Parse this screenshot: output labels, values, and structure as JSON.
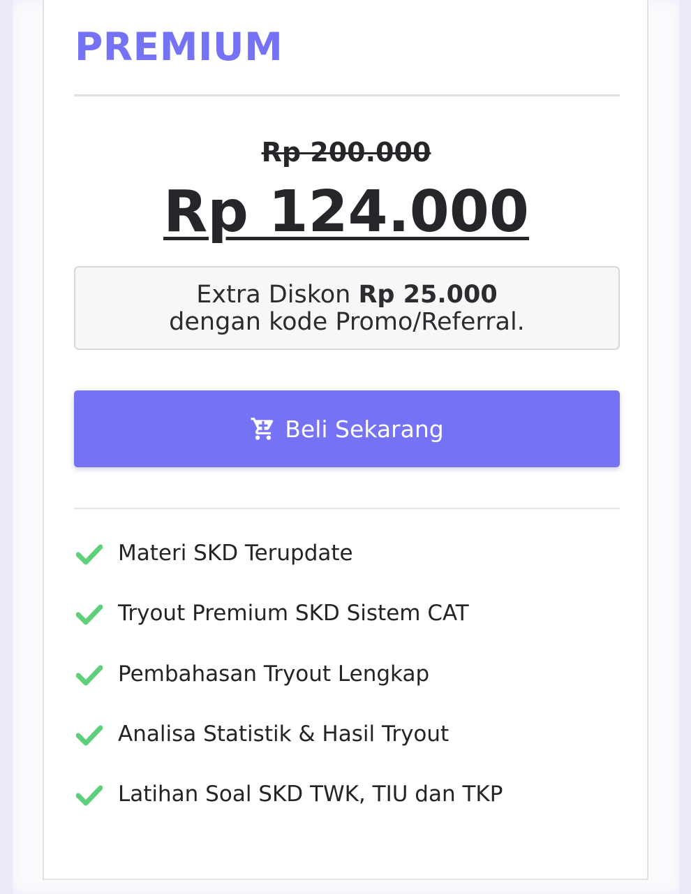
{
  "plan": {
    "title": "PREMIUM",
    "price_original": "Rp 200.000",
    "price_current": "Rp 124.000"
  },
  "promo": {
    "prefix": "Extra Diskon",
    "amount": "Rp 25.000",
    "line2": "dengan kode Promo/Referral."
  },
  "cta": {
    "label": "Beli Sekarang",
    "icon": "cart-icon"
  },
  "features": [
    {
      "label": "Materi SKD Terupdate",
      "icon": "check-icon"
    },
    {
      "label": "Tryout Premium SKD Sistem CAT",
      "icon": "check-icon"
    },
    {
      "label": "Pembahasan Tryout Lengkap",
      "icon": "check-icon"
    },
    {
      "label": "Analisa Statistik & Hasil Tryout",
      "icon": "check-icon"
    },
    {
      "label": "Latihan Soal SKD TWK, TIU dan TKP",
      "icon": "check-icon"
    }
  ],
  "colors": {
    "accent": "#7572f5",
    "check": "#5fd07a",
    "text": "#25252a",
    "page_background": "#ebeaf8"
  }
}
